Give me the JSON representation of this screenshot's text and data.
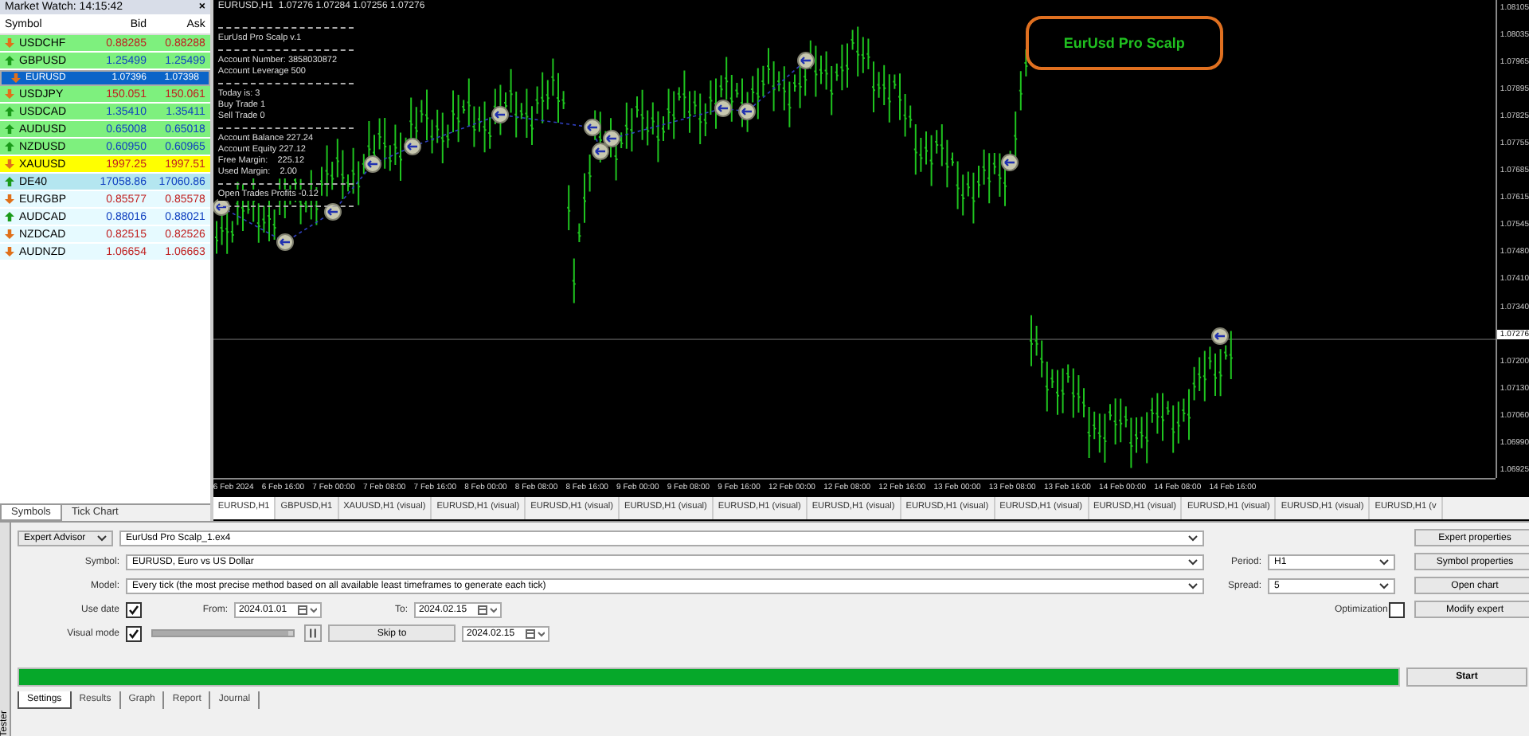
{
  "market_watch": {
    "title": "Market Watch: 14:15:42",
    "close": "×",
    "columns": [
      "Symbol",
      "Bid",
      "Ask"
    ],
    "rows": [
      {
        "symbol": "USDCHF",
        "bid": "0.88285",
        "ask": "0.88288",
        "rising": false,
        "color": "#7ef07e",
        "selected": false
      },
      {
        "symbol": "GBPUSD",
        "bid": "1.25499",
        "ask": "1.25499",
        "rising": true,
        "color": "#7ef07e",
        "selected": false
      },
      {
        "symbol": "EURUSD",
        "bid": "1.07396",
        "ask": "1.07398",
        "rising": false,
        "color": "#0a64c8",
        "selected": true
      },
      {
        "symbol": "USDJPY",
        "bid": "150.051",
        "ask": "150.061",
        "rising": false,
        "color": "#7ef07e",
        "selected": false
      },
      {
        "symbol": "USDCAD",
        "bid": "1.35410",
        "ask": "1.35411",
        "rising": true,
        "color": "#7ef07e",
        "selected": false
      },
      {
        "symbol": "AUDUSD",
        "bid": "0.65008",
        "ask": "0.65018",
        "rising": true,
        "color": "#7ef07e",
        "selected": false
      },
      {
        "symbol": "NZDUSD",
        "bid": "0.60950",
        "ask": "0.60965",
        "rising": true,
        "color": "#7ef07e",
        "selected": false
      },
      {
        "symbol": "XAUUSD",
        "bid": "1997.25",
        "ask": "1997.51",
        "rising": false,
        "color": "#ffff00",
        "selected": false
      },
      {
        "symbol": "DE40",
        "bid": "17058.86",
        "ask": "17060.86",
        "rising": true,
        "color": "#b4e6f0",
        "selected": false
      },
      {
        "symbol": "EURGBP",
        "bid": "0.85577",
        "ask": "0.85578",
        "rising": false,
        "color": "#e6faff",
        "selected": false
      },
      {
        "symbol": "AUDCAD",
        "bid": "0.88016",
        "ask": "0.88021",
        "rising": true,
        "color": "#e6faff",
        "selected": false
      },
      {
        "symbol": "NZDCAD",
        "bid": "0.82515",
        "ask": "0.82526",
        "rising": false,
        "color": "#e6faff",
        "selected": false
      },
      {
        "symbol": "AUDNZD",
        "bid": "1.06654",
        "ask": "1.06663",
        "rising": false,
        "color": "#e6faff",
        "selected": false
      }
    ],
    "tabs": [
      {
        "label": "Symbols",
        "selected": true
      },
      {
        "label": "Tick Chart",
        "selected": false
      }
    ]
  },
  "chart": {
    "header": "EURUSD,H1  1.07276 1.07284 1.07256 1.07276",
    "info_groups": [
      [
        "EurUsd Pro Scalp v.1"
      ],
      [
        "Account Number: 3858030872",
        "Account Leverage 500"
      ],
      [
        "Today is: 3",
        "Buy Trade 1",
        "Sell Trade 0"
      ],
      [
        "Account Balance 227.24",
        "Account Equity 227.12",
        "Free Margin:    225.12",
        "Used Margin:    2.00"
      ],
      [
        "Open Trades Profits -0.12"
      ]
    ],
    "badge": "EurUsd Pro Scalp",
    "price_ticks": [
      {
        "label": "1.08105",
        "highlighted": false
      },
      {
        "label": "1.08035",
        "highlighted": false
      },
      {
        "label": "1.07965",
        "highlighted": false
      },
      {
        "label": "1.07895",
        "highlighted": false
      },
      {
        "label": "1.07825",
        "highlighted": false
      },
      {
        "label": "1.07755",
        "highlighted": false
      },
      {
        "label": "1.07685",
        "highlighted": false
      },
      {
        "label": "1.07615",
        "highlighted": false
      },
      {
        "label": "1.07545",
        "highlighted": false
      },
      {
        "label": "1.07480",
        "highlighted": false
      },
      {
        "label": "1.07410",
        "highlighted": false
      },
      {
        "label": "1.07340",
        "highlighted": false
      },
      {
        "label": "1.07276",
        "highlighted": true
      },
      {
        "label": "1.07200",
        "highlighted": false
      },
      {
        "label": "1.07130",
        "highlighted": false
      },
      {
        "label": "1.07060",
        "highlighted": false
      },
      {
        "label": "1.06990",
        "highlighted": false
      },
      {
        "label": "1.06925",
        "highlighted": false
      }
    ],
    "time_ticks": [
      "6 Feb 2024",
      "6 Feb 16:00",
      "7 Feb 00:00",
      "7 Feb 08:00",
      "7 Feb 16:00",
      "8 Feb 00:00",
      "8 Feb 08:00",
      "8 Feb 16:00",
      "9 Feb 00:00",
      "9 Feb 08:00",
      "9 Feb 16:00",
      "12 Feb 00:00",
      "12 Feb 08:00",
      "12 Feb 16:00",
      "13 Feb 00:00",
      "13 Feb 08:00",
      "13 Feb 16:00",
      "14 Feb 00:00",
      "14 Feb 08:00",
      "14 Feb 16:00"
    ]
  },
  "chart_tabs": [
    {
      "label": "EURUSD,H1",
      "selected": true
    },
    {
      "label": "GBPUSD,H1",
      "selected": false
    },
    {
      "label": "XAUUSD,H1 (visual)",
      "selected": false
    },
    {
      "label": "EURUSD,H1 (visual)",
      "selected": false
    },
    {
      "label": "EURUSD,H1 (visual)",
      "selected": false
    },
    {
      "label": "EURUSD,H1 (visual)",
      "selected": false
    },
    {
      "label": "EURUSD,H1 (visual)",
      "selected": false
    },
    {
      "label": "EURUSD,H1 (visual)",
      "selected": false
    },
    {
      "label": "EURUSD,H1 (visual)",
      "selected": false
    },
    {
      "label": "EURUSD,H1 (visual)",
      "selected": false
    },
    {
      "label": "EURUSD,H1 (visual)",
      "selected": false
    },
    {
      "label": "EURUSD,H1 (visual)",
      "selected": false
    },
    {
      "label": "EURUSD,H1 (visual)",
      "selected": false
    },
    {
      "label": "EURUSD,H1 (v",
      "selected": false
    }
  ],
  "tester": {
    "side_label": "Tester",
    "type": "Expert Advisor",
    "expert": "EurUsd Pro Scalp_1.ex4",
    "symbol_label": "Symbol:",
    "symbol": "EURUSD, Euro vs US Dollar",
    "model_label": "Model:",
    "model": "Every tick (the most precise method based on all available least timeframes to generate each tick)",
    "use_date_label": "Use date",
    "use_date": true,
    "from_label": "From:",
    "from": "2024.01.01",
    "to_label": "To:",
    "to": "2024.02.15",
    "visual_label": "Visual mode",
    "visual": true,
    "speed": {
      "level": 0.97
    },
    "skip_to": "Skip to",
    "skip_date": "2024.02.15",
    "period_label": "Period:",
    "period": "H1",
    "spread_label": "Spread:",
    "spread": "5",
    "optimization_label": "Optimization",
    "optimization": false,
    "buttons": [
      "Expert properties",
      "Symbol properties",
      "Open chart",
      "Modify expert"
    ],
    "progress": {
      "level": 1
    },
    "start": "Start",
    "tabs": [
      {
        "label": "Settings",
        "selected": true
      },
      {
        "label": "Results",
        "selected": false
      },
      {
        "label": "Graph",
        "selected": false
      },
      {
        "label": "Report",
        "selected": false
      },
      {
        "label": "Journal",
        "selected": false
      }
    ]
  }
}
